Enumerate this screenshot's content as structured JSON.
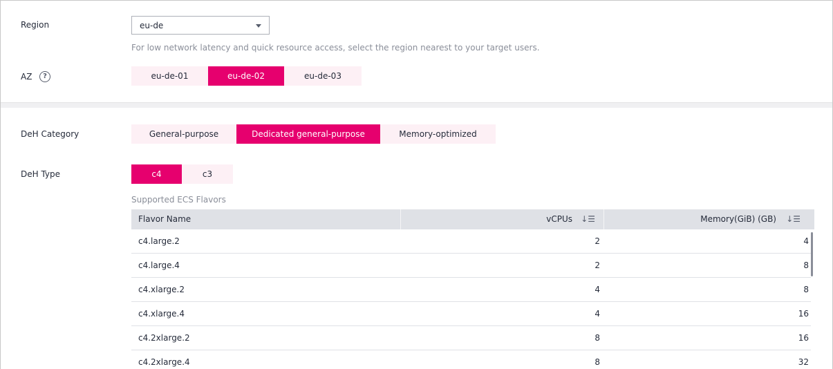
{
  "region": {
    "label": "Region",
    "selected": "eu-de",
    "hint": "For low network latency and quick resource access, select the region nearest to your target users."
  },
  "az": {
    "label": "AZ",
    "help_icon": "question-circle-icon",
    "options": [
      "eu-de-01",
      "eu-de-02",
      "eu-de-03"
    ],
    "selected": "eu-de-02"
  },
  "deh_category": {
    "label": "DeH Category",
    "options": [
      "General-purpose",
      "Dedicated general-purpose",
      "Memory-optimized"
    ],
    "selected": "Dedicated general-purpose"
  },
  "deh_type": {
    "label": "DeH Type",
    "options": [
      "c4",
      "c3"
    ],
    "selected": "c4"
  },
  "flavors": {
    "caption": "Supported ECS Flavors",
    "columns": [
      "Flavor Name",
      "vCPUs",
      "Memory(GiB)  (GB)"
    ],
    "sort_icon": "sort-descending-icon",
    "rows": [
      [
        "c4.large.2",
        "2",
        "4"
      ],
      [
        "c4.large.4",
        "2",
        "8"
      ],
      [
        "c4.xlarge.2",
        "4",
        "8"
      ],
      [
        "c4.xlarge.4",
        "4",
        "16"
      ],
      [
        "c4.2xlarge.2",
        "8",
        "16"
      ],
      [
        "c4.2xlarge.4",
        "8",
        "32"
      ]
    ]
  },
  "colors": {
    "accent": "#e6006e",
    "option_bg": "#fdf0f5",
    "table_header_bg": "#dfe1e6"
  }
}
